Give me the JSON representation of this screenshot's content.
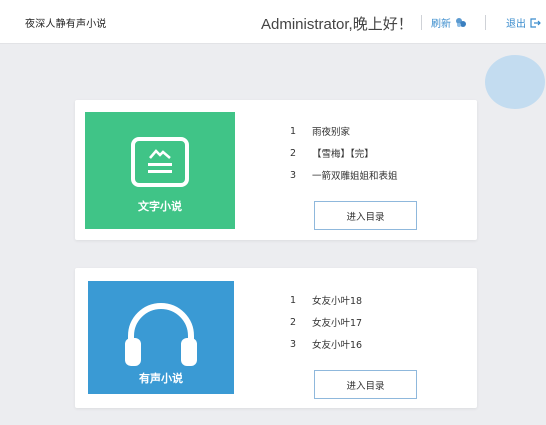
{
  "header": {
    "site_title": "夜深人静有声小说",
    "greeting": "Administrator,晚上好！",
    "refresh_label": "刷新",
    "logout_label": "退出"
  },
  "text_novels": {
    "tile_label": "文字小说",
    "items": [
      {
        "num": "1",
        "title": "雨夜别家"
      },
      {
        "num": "2",
        "title": "【雪梅】【完】"
      },
      {
        "num": "3",
        "title": "一箭双雕姐姐和表姐"
      }
    ],
    "enter_label": "进入目录"
  },
  "audio_novels": {
    "tile_label": "有声小说",
    "items": [
      {
        "num": "1",
        "title": "女友小叶18"
      },
      {
        "num": "2",
        "title": "女友小叶17"
      },
      {
        "num": "3",
        "title": "女友小叶16"
      }
    ],
    "enter_label": "进入目录"
  },
  "colors": {
    "text_tile": "#40c487",
    "audio_tile": "#3a9ad4",
    "link": "#3a8ccd",
    "background": "#ecedf0"
  }
}
